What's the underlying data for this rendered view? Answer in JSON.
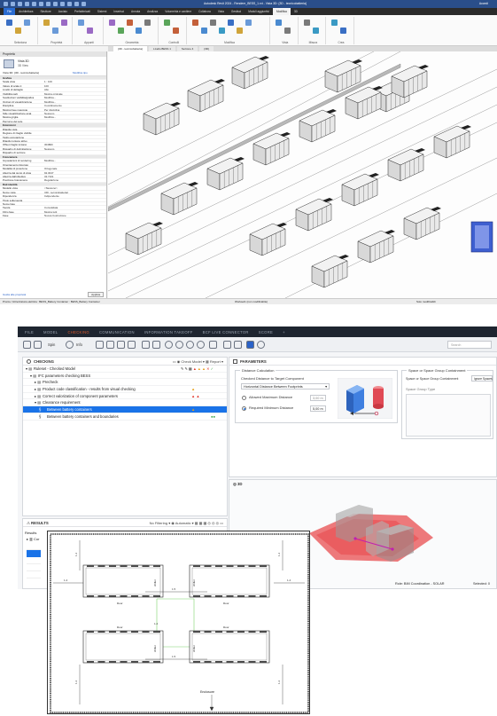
{
  "revit": {
    "title": "Autodesk Revit 2024 - Rendere_BESS_1.rvt - Vista 3D: {3D - Iconevaluta&#233;}",
    "title_clean": "Autodesk Revit 2024 - Rendere_BESS_1.rvt - Vista 3D: {3D - tecnicobatteria}",
    "user": "Accedi",
    "tabs": [
      "File",
      "Architettura",
      "Strutture",
      "Acciaio",
      "Prefabbricati",
      "Sistemi",
      "Inserisci",
      "Annota",
      "Analizza",
      "Volumetria e cantiere",
      "Collabora",
      "Vista",
      "Gestisci",
      "Moduli aggiuntivi",
      "Modifica",
      "3D"
    ],
    "ribbon_groups": [
      "Seleziona",
      "Proprietà",
      "Appunti",
      "Geometria",
      "Controlli",
      "Modifica",
      "Vista",
      "Misura",
      "Crea"
    ],
    "view_tabs": [
      "{3D - tecnicobatteria}",
      "Livello BESS 1",
      "Sezione 4",
      "{3D}"
    ],
    "properties": {
      "header": "Proprietà",
      "type_name": "Vista 3D",
      "type_sub": "3D View",
      "selector": "Vista 3D: {3D - tecnicobatteria}",
      "edit_type": "Modifica tipo",
      "rows": [
        {
          "k": "Grafica",
          "v": "",
          "sec": true
        },
        {
          "k": "Scala vista",
          "v": "1 : 100"
        },
        {
          "k": "Valore di scala 1:",
          "v": "100"
        },
        {
          "k": "Livello di dettaglio",
          "v": "Alto"
        },
        {
          "k": "Visibilità parti",
          "v": "Mostra originale"
        },
        {
          "k": "Sostituzioni visibilità/grafica",
          "v": "Modifica..."
        },
        {
          "k": "Opzioni di visualizzazione",
          "v": "Modifica..."
        },
        {
          "k": "Disciplina",
          "v": "Coordinamento"
        },
        {
          "k": "Mostra linee nascoste",
          "v": "Per disciplina"
        },
        {
          "k": "Stile visualizzazione anal.",
          "v": "Nessuno"
        },
        {
          "k": "Mostra griglia",
          "v": "Modifica..."
        },
        {
          "k": "Percorso del sole",
          "v": ""
        },
        {
          "k": "Estensioni",
          "v": "",
          "sec": true
        },
        {
          "k": "Ritaglia vista",
          "v": ""
        },
        {
          "k": "Regione di ritaglio visibile",
          "v": ""
        },
        {
          "k": "Taglio annotazione",
          "v": ""
        },
        {
          "k": "Ritaglio lontano attivo",
          "v": ""
        },
        {
          "k": "Offset ritaglio lontano",
          "v": "304800"
        },
        {
          "k": "Riquadro di delimitazione",
          "v": "Nessuno"
        },
        {
          "k": "Riquadro di sezione",
          "v": ""
        },
        {
          "k": "Fotocamera",
          "v": "",
          "sec": true
        },
        {
          "k": "Impostazioni di rendering",
          "v": "Modifica..."
        },
        {
          "k": "Orientamento bloccato",
          "v": ""
        },
        {
          "k": "Modalità di proiezione",
          "v": "Ortogonale"
        },
        {
          "k": "Altezza dal punto di vista",
          "v": "92.3047"
        },
        {
          "k": "Altezza dall'obiettivo",
          "v": "32.7101"
        },
        {
          "k": "Posizione fotocamera",
          "v": "Regolazione"
        },
        {
          "k": "Dati identità",
          "v": "",
          "sec": true
        },
        {
          "k": "Modello vista",
          "v": "<Nessuno>"
        },
        {
          "k": "Nome vista",
          "v": "{3D - tecnicobatteria}"
        },
        {
          "k": "Dipendenza",
          "v": "Indipendente"
        },
        {
          "k": "Titolo sulla tavola",
          "v": ""
        },
        {
          "k": "Nome fase",
          "v": ""
        },
        {
          "k": "Tavola",
          "v": "Consolidata"
        },
        {
          "k": "Filtro fase",
          "v": "Mostra tutti"
        },
        {
          "k": "Fase",
          "v": "Nuova Costruzione"
        }
      ],
      "help_link": "Guida alle proprietà",
      "apply": "Applica"
    },
    "status_left": "Pronto / Attrezzatura elettrica : BESS_Battery Container : BESS_Battery Container",
    "status_mid": "Workset1 (non modificabile)",
    "status_right": "Solo modificabili"
  },
  "solibri": {
    "menu": [
      "FILE",
      "MODEL",
      "CHECKING",
      "COMMUNICATION",
      "INFORMATION TAKEOFF",
      "BCF LIVE CONNECTOR",
      "SCORE",
      "+"
    ],
    "menu_active": "CHECKING",
    "toolbar": {
      "spin": "Spin",
      "info": "Info",
      "search_placeholder": "Search"
    },
    "checking": {
      "title": "CHECKING",
      "check_model": "Check Model",
      "report": "Report",
      "rows": [
        {
          "label": "Ruleset - Checked Model",
          "indent": 0,
          "marks": ""
        },
        {
          "label": "IFC parameters checking BESS",
          "indent": 1,
          "marks": ""
        },
        {
          "label": "Precheck",
          "indent": 2,
          "marks": ""
        },
        {
          "label": "Product code classification - results from visual checking",
          "indent": 2,
          "marks": "warn"
        },
        {
          "label": "Correct valorization of component parameters",
          "indent": 2,
          "marks": "crit"
        },
        {
          "label": "Clearance requirement",
          "indent": 2,
          "marks": ""
        },
        {
          "label": "Between battery containers",
          "indent": 3,
          "marks": "warn",
          "selected": true
        },
        {
          "label": "Between battery containers and boundaries",
          "indent": 3,
          "marks": "ok"
        }
      ]
    },
    "params": {
      "title": "PARAMETERS",
      "distance_calc_label": "Distance Calculation",
      "checked_distance_label": "Checked Distance to Target Component",
      "distance_mode": "Horizontal Distance Between Footprints",
      "allowed_max_label": "Allowed Maximum Distance",
      "allowed_max_value": "3,00 m",
      "required_min_label": "Required Minimum Distance",
      "required_min_value": "5,00 m",
      "space_group_label": "Space or Space Group Containment",
      "space_group_field": "Space or Space Group Containment",
      "space_group_value": "Ignore Spaces",
      "space_group_type": "Space Group Type"
    },
    "view3d": {
      "title": "3D"
    },
    "results": {
      "title": "RESULTS",
      "filter": "No Filtering",
      "automatic": "Automatic",
      "tree_root": "Results",
      "tree_item": "Cor"
    },
    "status": {
      "role": "Role: BIM Coordination - SOLAR",
      "selected": "Selected: 0"
    }
  },
  "drawing": {
    "container_label": "chiller",
    "door_label": "Door",
    "dimension_a": "1.5",
    "dimension_b": "1.2",
    "dimension_c": "1.4",
    "enclosure_label": "Enclosure"
  },
  "colors": {
    "revit_blue": "#2a4e8a",
    "solibri_dark": "#1e2530",
    "solibri_accent": "#e05a2b",
    "selection": "#1a73e8",
    "clearance_red": "#e8474a"
  }
}
